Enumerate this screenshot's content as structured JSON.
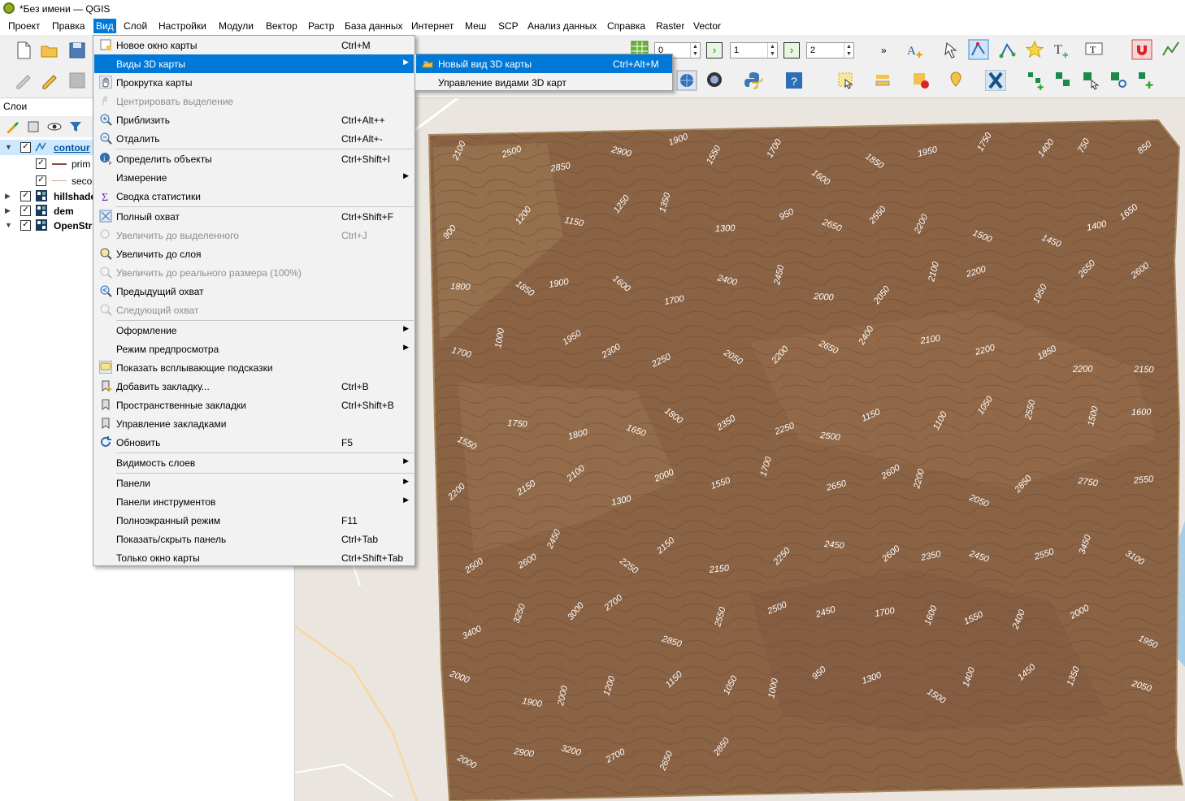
{
  "window": {
    "title": "*Без имени — QGIS"
  },
  "menubar": {
    "items": [
      "Проект",
      "Правка",
      "Вид",
      "Слой",
      "Настройки",
      "Модули",
      "Вектор",
      "Растр",
      "База данных",
      "Интернет",
      "Меш",
      "SCP",
      "Анализ данных",
      "Справка",
      "Raster",
      "Vector"
    ],
    "active": "Вид"
  },
  "toolbar": {
    "spin_values": [
      "0",
      "1",
      "2"
    ]
  },
  "layers_panel": {
    "title": "Слои",
    "layers": [
      {
        "name": "contour",
        "checked": true,
        "selected": true
      },
      {
        "name": "prim",
        "checked": true,
        "legend": true
      },
      {
        "name": "seco",
        "checked": true,
        "legend": true
      },
      {
        "name": "hillshade",
        "checked": true
      },
      {
        "name": "dem",
        "checked": true
      },
      {
        "name": "OpenStr",
        "checked": true
      }
    ]
  },
  "view_menu": {
    "items": [
      {
        "label": "Новое окно карты",
        "shortcut": "Ctrl+M",
        "icon": "new-map-window-icon"
      },
      {
        "label": "Виды 3D карты",
        "shortcut": "",
        "submenu": true,
        "highlighted": true
      },
      {
        "label": "Прокрутка карты",
        "shortcut": "",
        "icon": "pan-hand-icon"
      },
      {
        "label": "Центрировать выделение",
        "shortcut": "",
        "disabled": true,
        "icon": "pan-to-selection-icon"
      },
      {
        "label": "Приблизить",
        "shortcut": "Ctrl+Alt++",
        "icon": "zoom-in-icon"
      },
      {
        "label": "Отдалить",
        "shortcut": "Ctrl+Alt+-",
        "icon": "zoom-out-icon"
      },
      {
        "label": "Определить объекты",
        "shortcut": "Ctrl+Shift+I",
        "icon": "identify-icon"
      },
      {
        "label": "Измерение",
        "shortcut": "",
        "submenu": true
      },
      {
        "label": "Сводка статистики",
        "shortcut": "",
        "icon": "sigma-icon"
      },
      {
        "label": "Полный охват",
        "shortcut": "Ctrl+Shift+F",
        "icon": "zoom-full-icon"
      },
      {
        "label": "Увеличить до выделенного",
        "shortcut": "Ctrl+J",
        "disabled": true,
        "icon": "zoom-to-selection-icon"
      },
      {
        "label": "Увеличить до слоя",
        "shortcut": "",
        "icon": "zoom-to-layer-icon"
      },
      {
        "label": "Увеличить до реального размера (100%)",
        "shortcut": "",
        "disabled": true,
        "icon": "zoom-actual-icon"
      },
      {
        "label": "Предыдущий охват",
        "shortcut": "",
        "icon": "zoom-last-icon"
      },
      {
        "label": "Следующий охват",
        "shortcut": "",
        "disabled": true,
        "icon": "zoom-next-icon"
      },
      {
        "label": "Оформление",
        "shortcut": "",
        "submenu": true
      },
      {
        "label": "Режим предпросмотра",
        "shortcut": "",
        "submenu": true
      },
      {
        "label": "Показать всплывающие подсказки",
        "shortcut": "",
        "icon": "map-tips-icon"
      },
      {
        "label": "Добавить закладку...",
        "shortcut": "Ctrl+B",
        "icon": "new-bookmark-icon"
      },
      {
        "label": "Пространственные закладки",
        "shortcut": "Ctrl+Shift+B",
        "icon": "bookmarks-icon"
      },
      {
        "label": "Управление закладками",
        "shortcut": "",
        "icon": "manage-bookmarks-icon"
      },
      {
        "label": "Обновить",
        "shortcut": "F5",
        "icon": "refresh-icon"
      },
      {
        "label": "Видимость слоев",
        "shortcut": "",
        "submenu": true
      },
      {
        "label": "Панели",
        "shortcut": "",
        "submenu": true
      },
      {
        "label": "Панели инструментов",
        "shortcut": "",
        "submenu": true
      },
      {
        "label": "Полноэкранный режим",
        "shortcut": "F11"
      },
      {
        "label": "Показать/скрыть панель",
        "shortcut": "Ctrl+Tab"
      },
      {
        "label": "Только окно карты",
        "shortcut": "Ctrl+Shift+Tab"
      }
    ]
  },
  "submenu_3d": {
    "items": [
      {
        "label": "Новый вид 3D карты",
        "shortcut": "Ctrl+Alt+M",
        "icon": "new-3d-map-icon",
        "highlighted": true
      },
      {
        "label": "Управление  видами 3D  карт",
        "shortcut": ""
      }
    ]
  },
  "map": {
    "contour_labels": [
      "2100",
      "2500",
      "2850",
      "2900",
      "1900",
      "1550",
      "1700",
      "1600",
      "1850",
      "1950",
      "1750",
      "1400",
      "750",
      "850",
      "900",
      "1200",
      "1150",
      "1250",
      "1350",
      "1300",
      "950",
      "2650",
      "2550",
      "2200",
      "1500",
      "1450",
      "1400",
      "1650",
      "1800",
      "1850",
      "1900",
      "1600",
      "1700",
      "2400",
      "2450",
      "2000",
      "2050",
      "2100",
      "2200",
      "1950",
      "2650",
      "2600",
      "1700",
      "1000",
      "1950",
      "2300",
      "2250",
      "2050",
      "2200",
      "2650",
      "2400",
      "2100",
      "2200",
      "1850",
      "2200",
      "2150",
      "1550",
      "1750",
      "1800",
      "1650",
      "1800",
      "2350",
      "2250",
      "2500",
      "1150",
      "1100",
      "1050",
      "2550",
      "1500",
      "1600",
      "2200",
      "2150",
      "2100",
      "1300",
      "2000",
      "1550",
      "1700",
      "2650",
      "2600",
      "2200",
      "2050",
      "2850",
      "2750",
      "2550",
      "2500",
      "2600",
      "2450",
      "2250",
      "2150",
      "2150",
      "2250",
      "2450",
      "2600",
      "2350",
      "2450",
      "2550",
      "3450",
      "3100",
      "3400",
      "3250",
      "3000",
      "2700",
      "2850",
      "2550",
      "2500",
      "2450",
      "1700",
      "1600",
      "1550",
      "2400",
      "2000",
      "1950",
      "2000",
      "1900",
      "2000",
      "1200",
      "1150",
      "1050",
      "1000",
      "950",
      "1300",
      "1500",
      "1400",
      "1450",
      "1350",
      "2050",
      "2000",
      "2900",
      "3200",
      "2700",
      "2650",
      "2850"
    ]
  },
  "colors": {
    "accent": "#0078d7",
    "map_dem": "#8a6244",
    "map_edge": "#a88b5f",
    "map_base": "#eae6df",
    "lake": "#a9cde6"
  }
}
